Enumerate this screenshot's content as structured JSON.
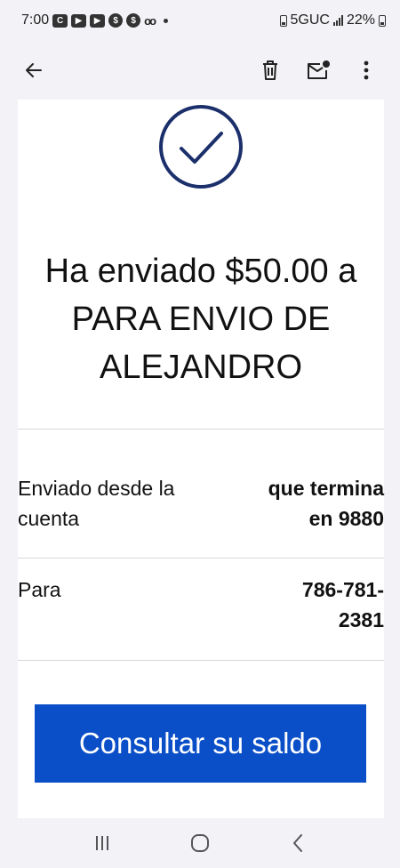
{
  "status_bar": {
    "time": "7:00",
    "notification_letter": "C",
    "network": "5GUC",
    "battery": "22%"
  },
  "app_bar": {
    "back_icon": "arrow-left-icon",
    "delete_icon": "trash-icon",
    "mark_unread_icon": "mail-unread-icon",
    "more_icon": "more-vertical-icon"
  },
  "message": {
    "check_icon": "checkmark-circle-icon",
    "headline": "Ha enviado $50.00 a PARA ENVIO DE ALEJANDRO",
    "from_label": "Enviado desde la cuenta",
    "from_value": "que termina en 9880",
    "to_label": "Para",
    "to_value": "786-781-2381",
    "cta_label": "Consultar su saldo"
  },
  "colors": {
    "accent": "#0b4fc8",
    "check": "#1b2f6b"
  },
  "nav_bar": {
    "recents_icon": "recents-icon",
    "home_icon": "home-icon",
    "back_icon": "nav-back-icon"
  }
}
